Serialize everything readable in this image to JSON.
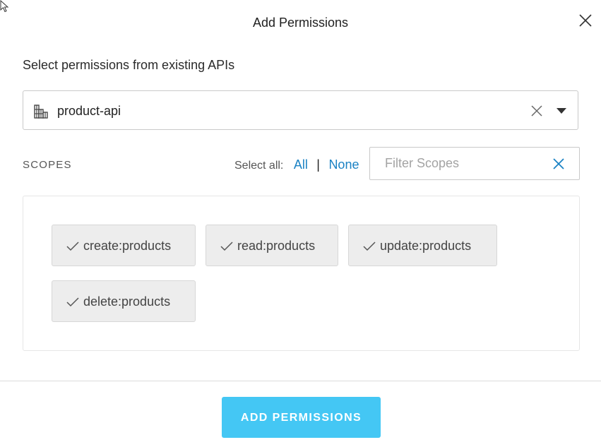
{
  "dialog": {
    "title": "Add Permissions",
    "close_icon": "close-icon"
  },
  "api_section": {
    "label": "Select permissions from existing APIs",
    "selected_api": "product-api",
    "api_icon": "building-icon",
    "clear_icon": "close-icon",
    "caret_icon": "caret-down-icon"
  },
  "scopes": {
    "heading": "SCOPES",
    "select_all_label": "Select all:",
    "all_link": "All",
    "separator": "|",
    "none_link": "None",
    "filter_placeholder": "Filter Scopes",
    "filter_value": "",
    "items": [
      {
        "label": "create:products",
        "selected": true
      },
      {
        "label": "read:products",
        "selected": true
      },
      {
        "label": "update:products",
        "selected": true
      },
      {
        "label": "delete:products",
        "selected": true
      }
    ]
  },
  "footer": {
    "add_button_label": "ADD PERMISSIONS"
  },
  "colors": {
    "accent": "#44c7f4",
    "link": "#1a82c4",
    "chip_bg": "#ededed"
  }
}
